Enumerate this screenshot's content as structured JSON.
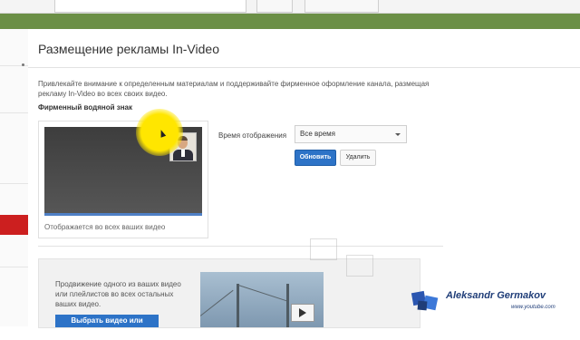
{
  "main": {
    "page_title": "Размещение рекламы In-Video",
    "description": "Привлекайте внимание к определенным материалам и поддерживайте фирменное оформление канала, размещая рекламу In-Video во всех своих видео.",
    "watermark": {
      "section_title": "Фирменный водяной знак",
      "caption": "Отображается во всех ваших видео",
      "display_time_label": "Время отображения",
      "display_time_value": "Все время",
      "save_button": "Обновить",
      "delete_button": "Удалить"
    },
    "promo": {
      "text": "Продвижение одного из ваших видео или плейлистов во всех остальных ваших видео.",
      "button": "Выбрать видео или плейлист"
    }
  },
  "overlay": {
    "brand_name": "Aleksandr Germakov",
    "brand_url": "www.youtube.com"
  },
  "colors": {
    "accent_blue": "#2d73c7",
    "header_green": "#6b8f46",
    "sidebar_red": "#cc1f1f",
    "cursor_highlight": "#ffe600"
  },
  "icons": [
    "play-icon",
    "chevron-down-icon",
    "cursor-icon",
    "logo-icon"
  ]
}
